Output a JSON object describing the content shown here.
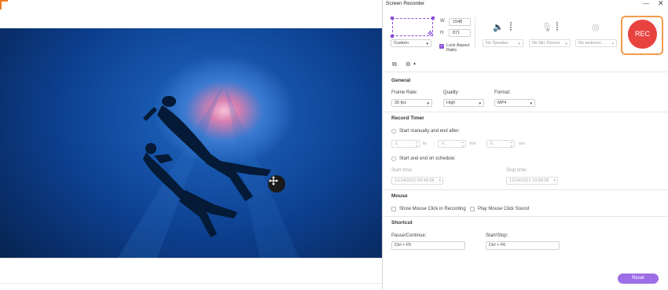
{
  "window": {
    "title": "Screen Recorder",
    "minimize": "—",
    "close": "✕"
  },
  "region": {
    "width_label": "W",
    "width_value": "1548",
    "height_label": "H",
    "height_value": "871",
    "preset": "Custom",
    "lock_aspect": "Lock Aspect Ratio",
    "lock_checked": true
  },
  "devices": {
    "speaker": "No Speaker",
    "mic": "No Mic Device",
    "webcam": "No webcam ..."
  },
  "rec_label": "REC",
  "general": {
    "title": "General",
    "frame_rate_label": "Frame Rate:",
    "frame_rate": "30 fps",
    "quality_label": "Quality:",
    "quality": "High",
    "format_label": "Format:",
    "format": "MP4"
  },
  "timer": {
    "title": "Record Timer",
    "manual_label": "Start manually and end after:",
    "hr_value": "1",
    "hr_unit": "hr",
    "min_value": "0",
    "min_unit": "min",
    "sec_value": "0",
    "sec_unit": "sec",
    "schedule_label": "Start and end on schedule:",
    "start_label": "Start time:",
    "start_value": "12/14/2021 09:48:58",
    "stop_label": "Stop time:",
    "stop_value": "12/14/2021 10:48:58"
  },
  "mouse": {
    "title": "Mouse",
    "show_click": "Show Mouse Click in Recording",
    "play_sound": "Play Mouse Click Sound"
  },
  "shortcut": {
    "title": "Shortcut",
    "pause_label": "Pause/Continue:",
    "pause_value": "Ctrl + F5",
    "startstop_label": "Start/Stop:",
    "startstop_value": "Ctrl + F6"
  },
  "reset_label": "Reset",
  "colors": {
    "accent": "#9e6ee6",
    "rec": "#e8423f",
    "highlight": "#f39b4a"
  }
}
